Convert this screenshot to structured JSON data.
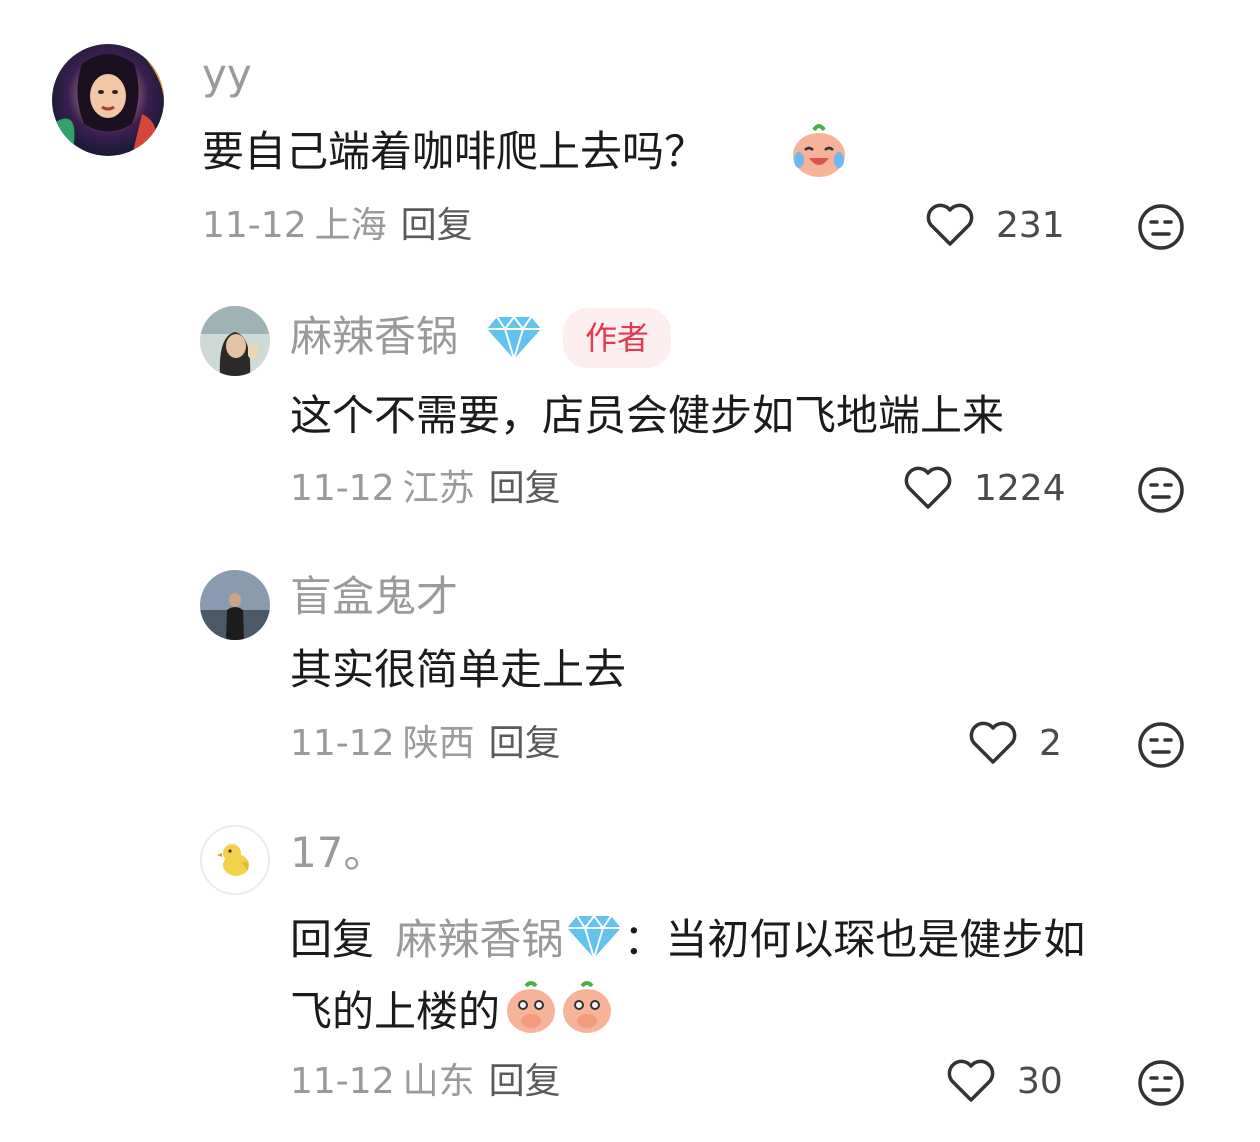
{
  "comments": [
    {
      "username": "yy",
      "text": "要自己端着咖啡爬上去吗？",
      "date": "11-12",
      "location": "上海",
      "reply_label": "回复",
      "likes": "231",
      "emoji": "laugh-cry-peach-emoji"
    },
    {
      "username": "麻辣香锅",
      "badge": "diamond-icon",
      "author_tag": "作者",
      "text": "这个不需要，店员会健步如飞地端上来",
      "date": "11-12",
      "location": "江苏",
      "reply_label": "回复",
      "likes": "1224"
    },
    {
      "username": "盲盒鬼才",
      "text": "其实很简单走上去",
      "date": "11-12",
      "location": "陕西",
      "reply_label": "回复",
      "likes": "2"
    },
    {
      "username": "17。",
      "reply_prefix": "回复",
      "reply_to": "麻辣香锅",
      "reply_sep": "：",
      "text_line1": "当初何以琛也是健步如",
      "text_line2": "飞的上楼的",
      "date": "11-12",
      "location": "山东",
      "reply_label": "回复",
      "likes": "30",
      "emoji": "covering-mouth-peach-emoji"
    }
  ],
  "colors": {
    "accent_author": "#e23a4f",
    "muted_text": "#9a9a9a"
  }
}
